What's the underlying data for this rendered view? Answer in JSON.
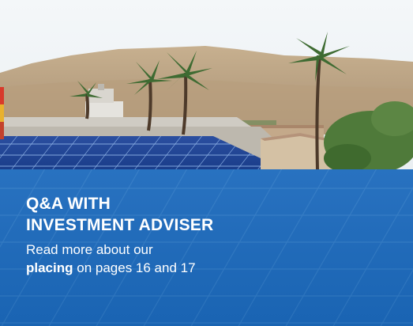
{
  "callout": {
    "title_line1": "Q&A WITH",
    "title_line2": "INVESTMENT ADVISER",
    "body_line1": "Read more about our",
    "body_bold": "placing",
    "body_rest": " on pages 16 and 17"
  },
  "colors": {
    "overlay": "#1f73c2",
    "sky": "#e8f0f5",
    "panel": "#1e4fa8"
  },
  "image": {
    "description_icon": "solar-panels-photo"
  }
}
